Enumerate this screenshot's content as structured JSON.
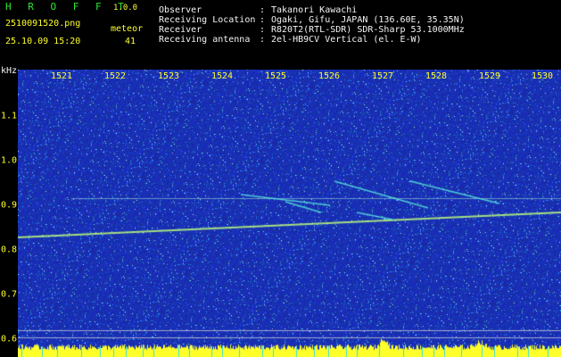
{
  "header": {
    "app_title": "H R O F F T",
    "app_version": "1.0.0",
    "file_name": "2510091520.png",
    "date_time": "25.10.09 15:20",
    "meteor_label": "meteor",
    "meteor_count": "41"
  },
  "info": [
    {
      "key": "Observer",
      "sep": ":",
      "value": "Takanori Kawachi"
    },
    {
      "key": "Receiving Location",
      "sep": ":",
      "value": "Ogaki, Gifu, JAPAN (136.60E, 35.35N)"
    },
    {
      "key": "Receiver",
      "sep": ":",
      "value": "R820T2(RTL-SDR) SDR-Sharp 53.1000MHz"
    },
    {
      "key": "Receiving antenna",
      "sep": ":",
      "value": "2el-HB9CV Vertical (el. E-W)"
    }
  ],
  "axes": {
    "y_unit": "kHz",
    "x_ticks": [
      "1521",
      "1522",
      "1523",
      "1524",
      "1525",
      "1526",
      "1527",
      "1528",
      "1529",
      "1530"
    ],
    "y_ticks": [
      "1.1",
      "1.0",
      "0.9",
      "0.8",
      "0.7",
      "0.6"
    ]
  },
  "colors": {
    "background": "#000000",
    "spectrogram_base": "#1a2ca8",
    "title_green": "#2fe82f",
    "tick_yellow": "#ffff2a",
    "trace_cyan": "#4ff0e0",
    "trace_yellow": "#d8ff5a"
  }
}
